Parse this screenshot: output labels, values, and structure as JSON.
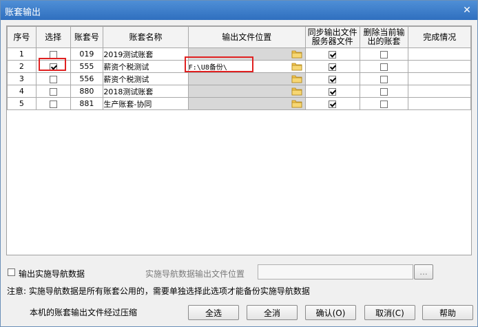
{
  "window": {
    "title": "账套输出"
  },
  "grid": {
    "headers": {
      "seq": "序号",
      "select": "选择",
      "code": "账套号",
      "name": "账套名称",
      "path": "输出文件位置",
      "sync_l1": "同步输出文件",
      "sync_l2": "服务器文件",
      "del_l1": "删除当前输",
      "del_l2": "出的账套",
      "status": "完成情况"
    },
    "rows": [
      {
        "seq": "1",
        "code": "019",
        "name": "2019测试账套",
        "path": "",
        "selected": false,
        "sync": true,
        "delete": false
      },
      {
        "seq": "2",
        "code": "555",
        "name": "薪资个税测试",
        "path": "F:\\U8备份\\",
        "selected": true,
        "sync": true,
        "delete": false
      },
      {
        "seq": "3",
        "code": "556",
        "name": "薪资个税测试",
        "path": "",
        "selected": false,
        "sync": true,
        "delete": false
      },
      {
        "seq": "4",
        "code": "880",
        "name": "2018测试账套",
        "path": "",
        "selected": false,
        "sync": true,
        "delete": false
      },
      {
        "seq": "5",
        "code": "881",
        "name": "生产账套-协同",
        "path": "",
        "selected": false,
        "sync": true,
        "delete": false
      }
    ]
  },
  "options": {
    "export_nav_label": "输出实施导航数据",
    "nav_path_label": "实施导航数据输出文件位置",
    "nav_path_value": "",
    "browse_label": "...",
    "note": "注意: 实施导航数据是所有账套公用的，需要单独选择此选项才能备份实施导航数据",
    "compress_note": "本机的账套输出文件经过压缩"
  },
  "buttons": {
    "select_all": "全选",
    "clear_all": "全消",
    "confirm": "确认(O)",
    "cancel": "取消(C)",
    "help": "帮助"
  }
}
